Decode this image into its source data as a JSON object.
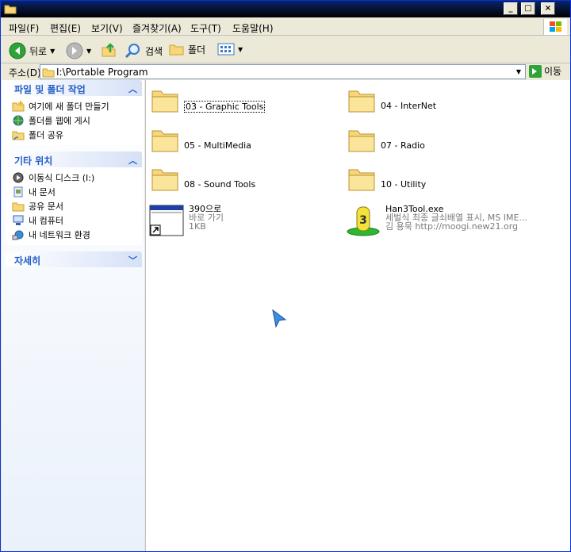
{
  "window": {
    "min_glyph": "_",
    "max_glyph": "□",
    "close_glyph": "×"
  },
  "menu": [
    "파일(F)",
    "편집(E)",
    "보기(V)",
    "즐겨찾기(A)",
    "도구(T)",
    "도움말(H)"
  ],
  "toolbar": {
    "back_label": "뒤로",
    "search_label": "검색",
    "folders_label": "폴더"
  },
  "address": {
    "label": "주소(D)",
    "path": "I:\\Portable Program",
    "go_label": "이동"
  },
  "left_panels": {
    "tasks": {
      "title": "파일 및 폴더 작업",
      "items": [
        "여기에 새 폴더 만들기",
        "폴더를 웹에 게시",
        "폴더 공유"
      ]
    },
    "other_places": {
      "title": "기타 위치",
      "items": [
        "이동식 디스크 (I:)",
        "내 문서",
        "공유 문서",
        "내 컴퓨터",
        "내 네트워크 환경"
      ]
    },
    "details": {
      "title": "자세히"
    }
  },
  "files": [
    {
      "name": "03 - Graphic Tools",
      "type": "folder",
      "selected": true
    },
    {
      "name": "04 - InterNet",
      "type": "folder"
    },
    {
      "name": "05 - MultiMedia",
      "type": "folder"
    },
    {
      "name": "07 - Radio",
      "type": "folder"
    },
    {
      "name": "08 - Sound Tools",
      "type": "folder"
    },
    {
      "name": "10 - Utility",
      "type": "folder"
    },
    {
      "name": "390으로",
      "type": "shortcut",
      "line2": "바로 가기",
      "line3": "1KB"
    },
    {
      "name": "Han3Tool.exe",
      "type": "exe",
      "line2": "세벌식 최종 글쇠배열 표시, MS IME...",
      "line3": "김 용묵 http://moogi.new21.org"
    }
  ],
  "colors": {
    "panel_title": "#215dc6",
    "folder_yellow": "#f7d777",
    "back_green": "#2fa33a"
  }
}
